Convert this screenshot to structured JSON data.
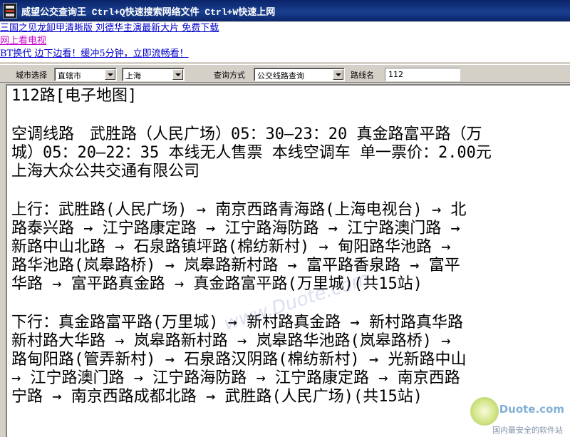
{
  "window": {
    "title": "威望公交查询王 Ctrl+Q快速搜索网络文件 Ctrl+W快速上网"
  },
  "ads": [
    {
      "text": "三国之见龙卸甲清晰版 刘德华主演最新大片 免费下载",
      "color": "#0000cc"
    },
    {
      "text": "网上看电视",
      "color": "#cc00cc"
    },
    {
      "text": "BT换代 边下边看！缓冲5分钟，立即流畅看！",
      "color": "#0000cc"
    }
  ],
  "toolbar": {
    "city_label": "城市选择",
    "city_type_value": "直辖市",
    "city_value": "上海",
    "mode_label": "查询方式",
    "mode_value": "公交线路查询",
    "route_label": "路线名",
    "route_value": "112"
  },
  "content": {
    "lines": [
      "112路[电子地图]",
      "",
      "空调线路　武胜路（人民广场）05：30—23：20 真金路富平路（万",
      "城）05：20—22：35 本线无人售票 本线空调车 单一票价：2.00元",
      "上海大众公共交通有限公司",
      "",
      "上行：武胜路(人民广场) → 南京西路青海路(上海电视台) → 北",
      "路泰兴路 → 江宁路康定路 → 江宁路海防路 → 江宁路澳门路 →",
      "新路中山北路 → 石泉路镇坪路(棉纺新村) → 甸阳路华池路 →",
      "路华池路(岚皋路桥) → 岚皋路新村路 → 富平路香泉路 → 富平",
      "华路 → 富平路真金路 → 真金路富平路(万里城)(共15站)",
      "",
      "下行：真金路富平路(万里城) → 新村路真金路 → 新村路真华路",
      "新村路大华路 → 岚皋路新村路 → 岚皋路华池路(岚皋路桥) →",
      "路甸阳路(管弄新村) → 石泉路汉阴路(棉纺新村) → 光新路中山",
      "→ 江宁路澳门路 → 江宁路海防路 → 江宁路康定路 → 南京西路",
      "宁路 → 南京西路成都北路 → 武胜路(人民广场)(共15站)"
    ]
  },
  "watermark": {
    "text": "www.Duote.com",
    "logo_text": "Duote.com",
    "tagline": "国内最安全的软件站"
  }
}
